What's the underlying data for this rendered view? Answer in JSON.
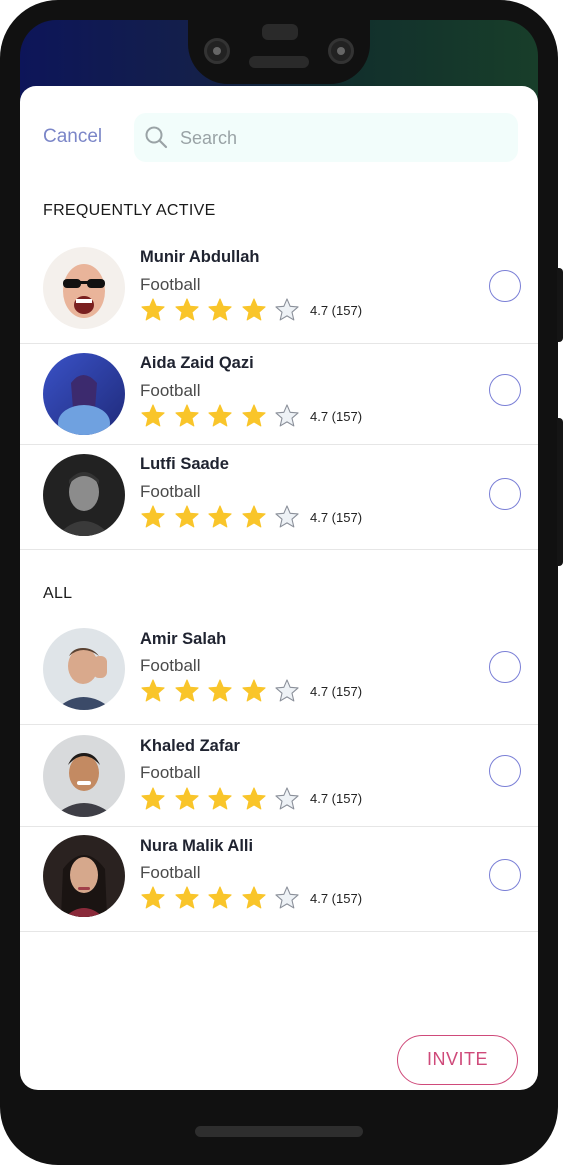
{
  "header": {
    "cancel_label": "Cancel",
    "search_placeholder": "Search"
  },
  "sections": [
    {
      "title": "FREQUENTLY ACTIVE",
      "people": [
        {
          "name": "Munir Abdullah",
          "sport": "Football",
          "stars_filled": 4,
          "stars_total": 5,
          "rating": "4.7 (157)"
        },
        {
          "name": "Aida Zaid Qazi",
          "sport": "Football",
          "stars_filled": 4,
          "stars_total": 5,
          "rating": "4.7 (157)"
        },
        {
          "name": "Lutfi Saade",
          "sport": "Football",
          "stars_filled": 4,
          "stars_total": 5,
          "rating": "4.7 (157)"
        }
      ]
    },
    {
      "title": "ALL",
      "people": [
        {
          "name": "Amir Salah",
          "sport": "Football",
          "stars_filled": 4,
          "stars_total": 5,
          "rating": "4.7 (157)"
        },
        {
          "name": "Khaled Zafar",
          "sport": "Football",
          "stars_filled": 4,
          "stars_total": 5,
          "rating": "4.7 (157)"
        },
        {
          "name": "Nura Malik Alli",
          "sport": "Football",
          "stars_filled": 4,
          "stars_total": 5,
          "rating": "4.7 (157)"
        }
      ]
    }
  ],
  "footer": {
    "invite_label": "INVITE"
  },
  "colors": {
    "accent": "#7b86c8",
    "radio": "#7a7fd6",
    "star_filled": "#f9c52a",
    "invite": "#cf4a7a",
    "search_bg": "#f2fdfb"
  }
}
